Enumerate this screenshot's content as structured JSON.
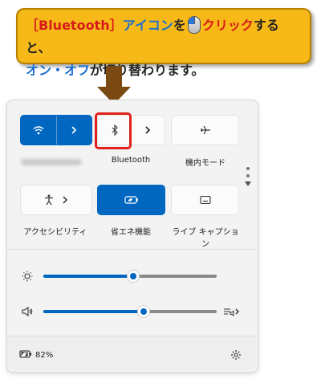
{
  "callout": {
    "part1": "［Bluetooth］",
    "part2": "アイコン",
    "part3": "を",
    "part4": "クリック",
    "part5": "すると、",
    "part6": "オン・オフ",
    "part7": "が切り替わります。"
  },
  "tiles": {
    "wifi": {
      "state": "on"
    },
    "bluetooth": {
      "label": "Bluetooth",
      "state": "off"
    },
    "airplane": {
      "label": "機内モード",
      "state": "off"
    },
    "accessibility": {
      "label": "アクセシビリティ",
      "state": "off"
    },
    "battery_saver": {
      "label": "省エネ機能",
      "state": "on"
    },
    "live_caption": {
      "label": "ライブ キャプション",
      "state": "off"
    }
  },
  "sliders": {
    "brightness": {
      "value_percent": 52
    },
    "volume": {
      "value_percent": 58
    }
  },
  "footer": {
    "battery": "82%"
  },
  "colors": {
    "accent": "#0067c0",
    "callout_bg": "#f6b917",
    "highlight_red": "#e0201a",
    "arrow": "#7b4a12"
  }
}
